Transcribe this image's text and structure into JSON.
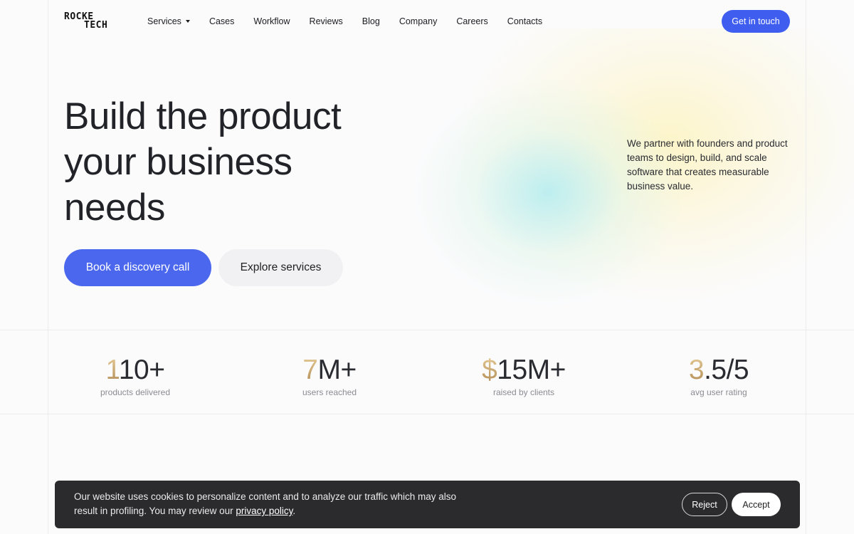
{
  "brand": {
    "logo_line1": "ROCKE",
    "logo_line2": "TECH"
  },
  "nav": {
    "items": [
      {
        "label": "Services",
        "has_dropdown": true
      },
      {
        "label": "Cases"
      },
      {
        "label": "Workflow"
      },
      {
        "label": "Reviews"
      },
      {
        "label": "Blog"
      },
      {
        "label": "Company"
      },
      {
        "label": "Careers"
      },
      {
        "label": "Contacts"
      }
    ],
    "cta": "Get in touch"
  },
  "hero": {
    "title_line1": "Build the product",
    "title_line2": "your business",
    "title_line3": "needs",
    "description": "We partner with founders and product teams to design, build, and scale software that creates measurable business value.",
    "primary_button": "Book a discovery call",
    "secondary_button": "Explore services"
  },
  "stats": [
    {
      "accent": "1",
      "rest": "10+",
      "label": "products delivered"
    },
    {
      "accent": "7",
      "rest": "M+",
      "label": "users reached"
    },
    {
      "accent": "$",
      "rest": "15M+",
      "label": "raised by clients"
    },
    {
      "accent": "3",
      "rest": ".5/5",
      "label": "avg user rating"
    }
  ],
  "cookie": {
    "text_before": "Our website uses cookies to personalize content and to analyze our traffic which may also result in profiling. You may review our ",
    "link_text": "privacy policy",
    "text_after": ".",
    "reject": "Reject",
    "accept": "Accept"
  },
  "colors": {
    "accent_blue": "#4a67ee",
    "gold": "#c9a66b",
    "cookie_bg": "#2b2b2d"
  }
}
